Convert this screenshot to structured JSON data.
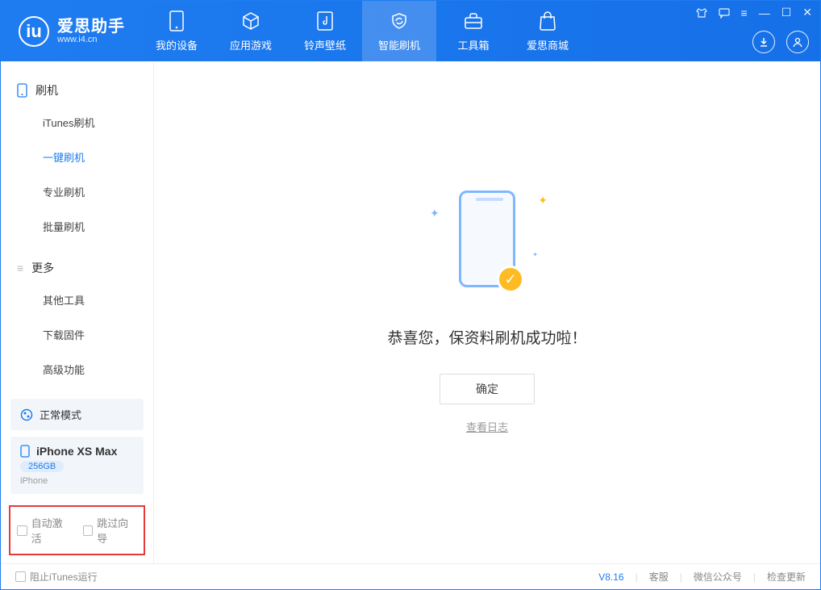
{
  "app": {
    "title": "爱思助手",
    "subtitle": "www.i4.cn"
  },
  "nav": {
    "tabs": [
      {
        "label": "我的设备"
      },
      {
        "label": "应用游戏"
      },
      {
        "label": "铃声壁纸"
      },
      {
        "label": "智能刷机"
      },
      {
        "label": "工具箱"
      },
      {
        "label": "爱思商城"
      }
    ]
  },
  "sidebar": {
    "groups": [
      {
        "title": "刷机",
        "items": [
          "iTunes刷机",
          "一键刷机",
          "专业刷机",
          "批量刷机"
        ]
      },
      {
        "title": "更多",
        "items": [
          "其他工具",
          "下载固件",
          "高级功能"
        ]
      }
    ],
    "mode_label": "正常模式",
    "device": {
      "name": "iPhone XS Max",
      "storage": "256GB",
      "type": "iPhone"
    },
    "options": {
      "auto_activate": "自动激活",
      "skip_guide": "跳过向导"
    }
  },
  "main": {
    "success_text": "恭喜您，保资料刷机成功啦！",
    "ok_button": "确定",
    "view_log": "查看日志"
  },
  "status": {
    "block_itunes": "阻止iTunes运行",
    "version": "V8.16",
    "links": [
      "客服",
      "微信公众号",
      "检查更新"
    ]
  }
}
